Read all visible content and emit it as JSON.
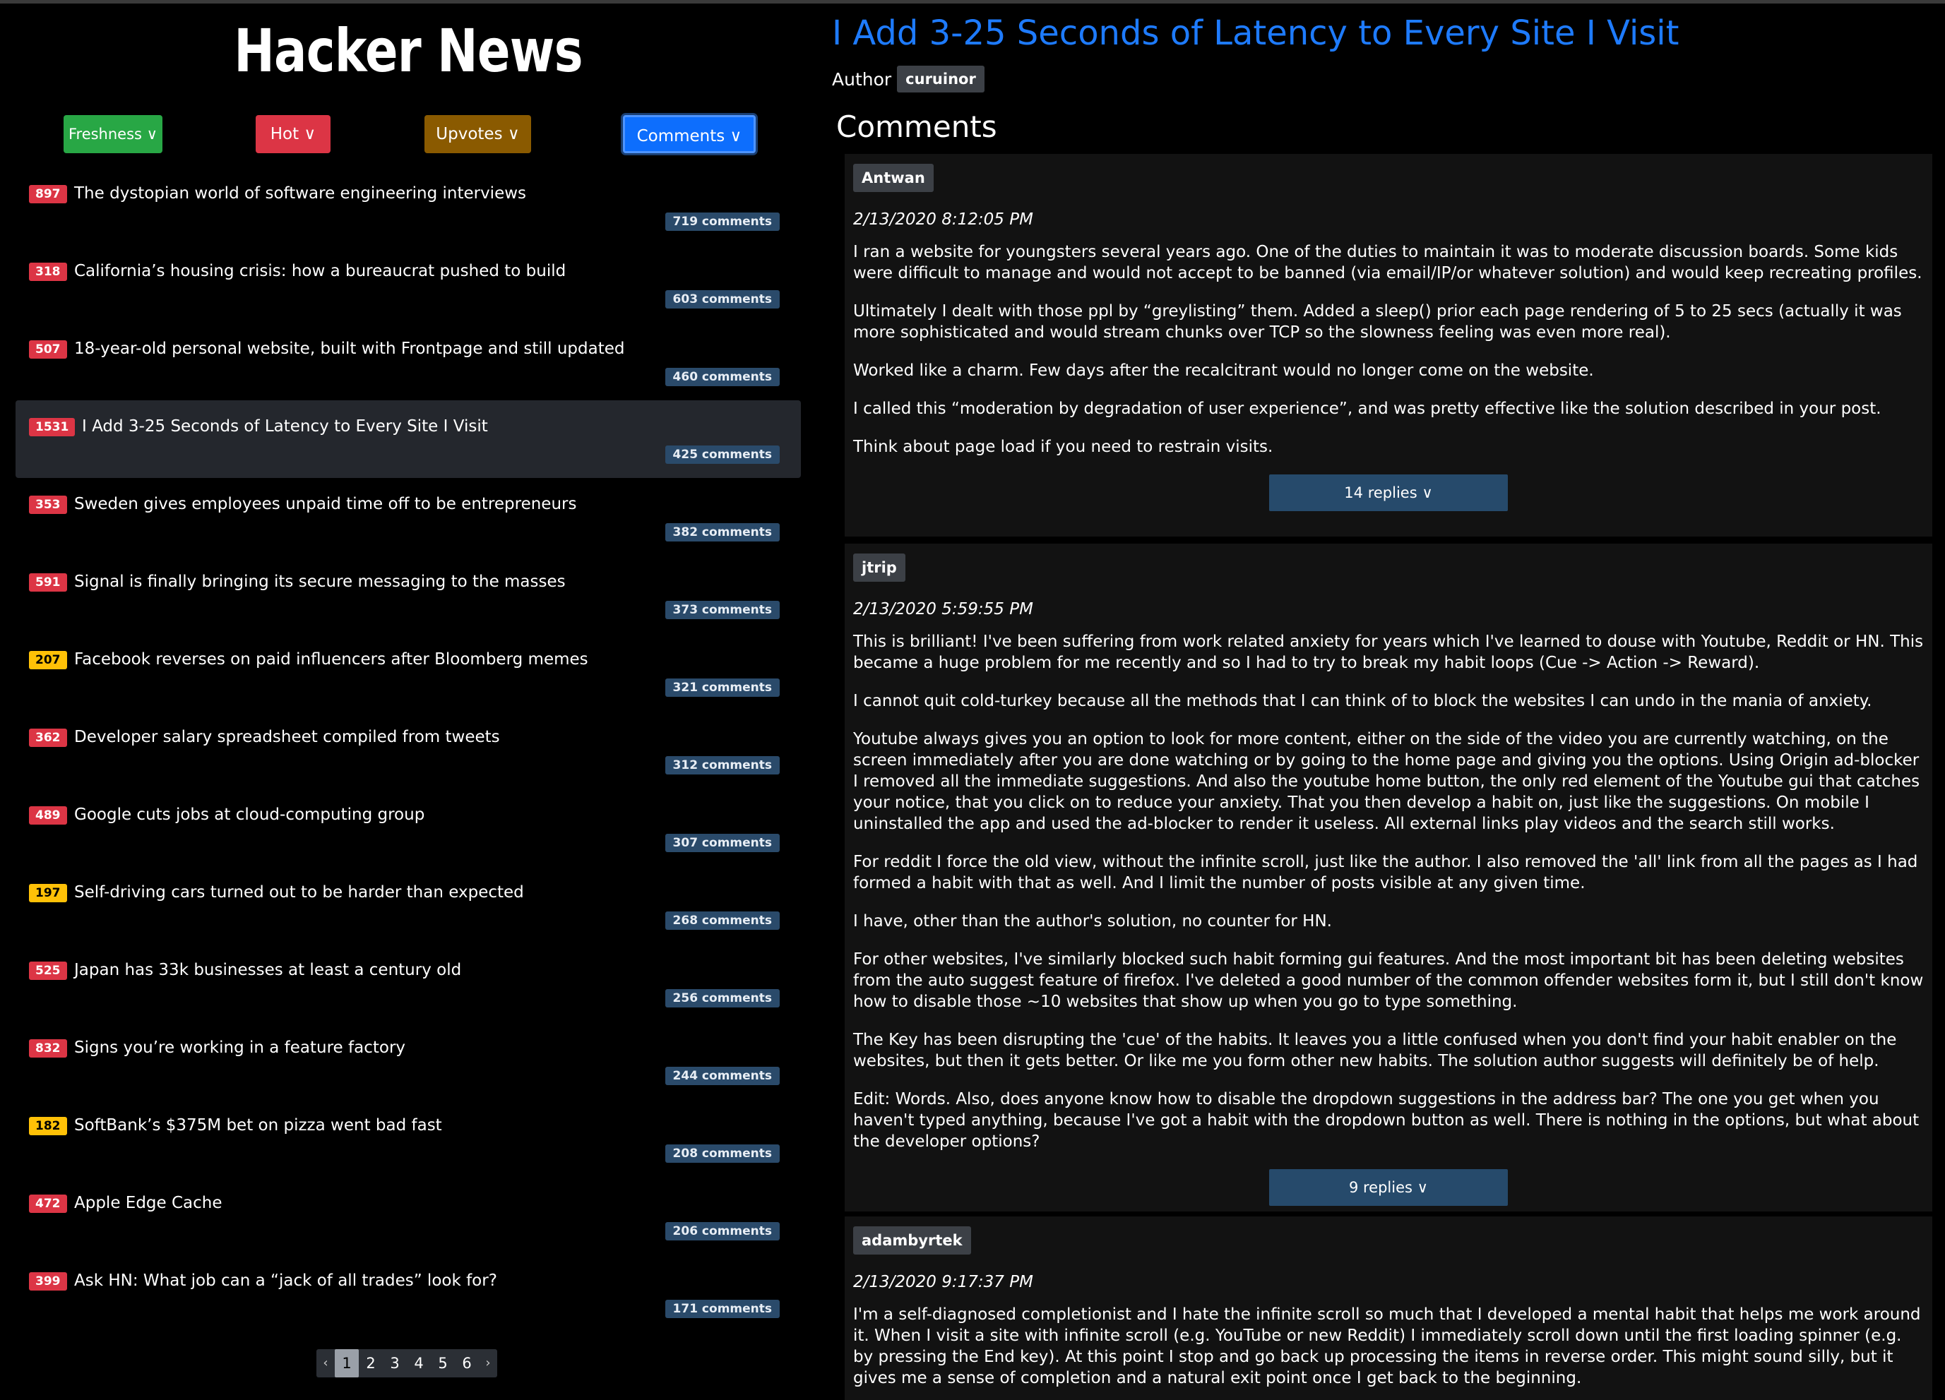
{
  "app": {
    "logo": "Hacker News"
  },
  "sort": {
    "freshness": "Freshness ∨",
    "hot": "Hot ∨",
    "upvotes": "Upvotes ∨",
    "comments": "Comments ∨"
  },
  "stories": [
    {
      "score": "897",
      "title": "The dystopian world of software engineering interviews",
      "comments": "719 comments",
      "score_color": "red"
    },
    {
      "score": "318",
      "title": "California’s housing crisis: how a bureaucrat pushed to build",
      "comments": "603 comments",
      "score_color": "red"
    },
    {
      "score": "507",
      "title": "18-year-old personal website, built with Frontpage and still updated",
      "comments": "460 comments",
      "score_color": "red"
    },
    {
      "score": "1531",
      "title": "I Add 3-25 Seconds of Latency to Every Site I Visit",
      "comments": "425 comments",
      "score_color": "red",
      "active": true
    },
    {
      "score": "353",
      "title": "Sweden gives employees unpaid time off to be entrepreneurs",
      "comments": "382 comments",
      "score_color": "red"
    },
    {
      "score": "591",
      "title": "Signal is finally bringing its secure messaging to the masses",
      "comments": "373 comments",
      "score_color": "red"
    },
    {
      "score": "207",
      "title": "Facebook reverses on paid influencers after Bloomberg memes",
      "comments": "321 comments",
      "score_color": "yellow"
    },
    {
      "score": "362",
      "title": "Developer salary spreadsheet compiled from tweets",
      "comments": "312 comments",
      "score_color": "red"
    },
    {
      "score": "489",
      "title": "Google cuts jobs at cloud-computing group",
      "comments": "307 comments",
      "score_color": "red"
    },
    {
      "score": "197",
      "title": "Self-driving cars turned out to be harder than expected",
      "comments": "268 comments",
      "score_color": "yellow"
    },
    {
      "score": "525",
      "title": "Japan has 33k businesses at least a century old",
      "comments": "256 comments",
      "score_color": "red"
    },
    {
      "score": "832",
      "title": "Signs you’re working in a feature factory",
      "comments": "244 comments",
      "score_color": "red"
    },
    {
      "score": "182",
      "title": "SoftBank’s $375M bet on pizza went bad fast",
      "comments": "208 comments",
      "score_color": "yellow"
    },
    {
      "score": "472",
      "title": "Apple Edge Cache",
      "comments": "206 comments",
      "score_color": "red"
    },
    {
      "score": "399",
      "title": "Ask HN: What job can a “jack of all trades” look for?",
      "comments": "171 comments",
      "score_color": "red"
    }
  ],
  "pager": {
    "prev": "‹",
    "next": "›",
    "pages": [
      "1",
      "2",
      "3",
      "4",
      "5",
      "6"
    ],
    "current": "1"
  },
  "post": {
    "title": "I Add 3-25 Seconds of Latency to Every Site I Visit",
    "author_label": "Author",
    "author": "curuinor",
    "comments_heading": "Comments"
  },
  "comments": [
    {
      "user": "Antwan",
      "date": "2/13/2020 8:12:05 PM",
      "paragraphs": [
        "I ran a website for youngsters several years ago. One of the duties to maintain it was to moderate discussion boards. Some kids were difficult to manage and would not accept to be banned (via email/IP/or whatever solution) and would keep recreating profiles.",
        "Ultimately I dealt with those ppl by “greylisting” them. Added a sleep() prior each page rendering of 5 to 25 secs (actually it was more sophisticated and would stream chunks over TCP so the slowness feeling was even more real).",
        "Worked like a charm. Few days after the recalcitrant would no longer come on the website.",
        "I called this “moderation by degradation of user experience”, and was pretty effective like the solution described in your post.",
        "Think about page load if you need to restrain visits."
      ],
      "replies": "14 replies ∨"
    },
    {
      "user": "jtrip",
      "date": "2/13/2020 5:59:55 PM",
      "paragraphs": [
        "This is brilliant! I've been suffering from work related anxiety for years which I've learned to douse with Youtube, Reddit or HN. This became a huge problem for me recently and so I had to try to break my habit loops (Cue -> Action -> Reward).",
        "I cannot quit cold-turkey because all the methods that I can think of to block the websites I can undo in the mania of anxiety.",
        "Youtube always gives you an option to look for more content, either on the side of the video you are currently watching, on the screen immediately after you are done watching or by going to the home page and giving you the options. Using Origin ad-blocker I removed all the immediate suggestions. And also the youtube home button, the only red element of the Youtube gui that catches your notice, that you click on to reduce your anxiety. That you then develop a habit on, just like the suggestions. On mobile I uninstalled the app and used the ad-blocker to render it useless. All external links play videos and the search still works.",
        "For reddit I force the old view, without the infinite scroll, just like the author. I also removed the 'all' link from all the pages as I had formed a habit with that as well. And I limit the number of posts visible at any given time.",
        "I have, other than the author's solution, no counter for HN.",
        "For other websites, I've similarly blocked such habit forming gui features. And the most important bit has been deleting websites from the auto suggest feature of firefox. I've deleted a good number of the common offender websites form it, but I still don't know how to disable those ~10 websites that show up when you go to type something.",
        "The Key has been disrupting the 'cue' of the habits. It leaves you a little confused when you don't find your habit enabler on the websites, but then it gets better. Or like me you form other new habits. The solution author suggests will definitely be of help.",
        "Edit: Words. Also, does anyone know how to disable the dropdown suggestions in the address bar? The one you get when you haven't typed anything, because I've got a habit with the dropdown button as well. There is nothing in the options, but what about the developer options?"
      ],
      "replies": "9 replies ∨"
    },
    {
      "user": "adambyrtek",
      "date": "2/13/2020 9:17:37 PM",
      "paragraphs": [
        "I'm a self-diagnosed completionist and I hate the infinite scroll so much that I developed a mental habit that helps me work around it. When I visit a site with infinite scroll (e.g. YouTube or new Reddit) I immediately scroll down until the first loading spinner (e.g. by pressing the End key). At this point I stop and go back up processing the items in reverse order. This might sound silly, but it gives me a sense of completion and a natural exit point once I get back to the beginning."
      ]
    }
  ],
  "colors": {
    "accent": "#1e7bff",
    "score_red": "#dc3545",
    "score_yellow": "#ffc107",
    "fresh": "#28a745",
    "upvotes": "#8a5a00",
    "badge": "#2a4a6a"
  }
}
